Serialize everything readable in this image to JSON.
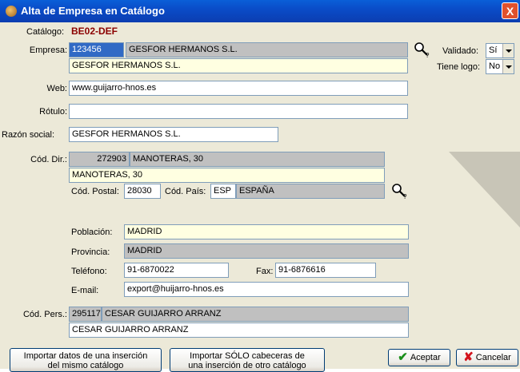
{
  "window": {
    "title": "Alta de Empresa en Catálogo",
    "close": "X"
  },
  "catalogo": {
    "label": "Catálogo:",
    "value": "BE02-DEF"
  },
  "empresa": {
    "label": "Empresa:",
    "code": "123456",
    "name": "GESFOR HERMANOS S.L.",
    "display_name": "GESFOR HERMANOS S.L."
  },
  "validado": {
    "label": "Validado:",
    "value": "Sí"
  },
  "tiene_logo": {
    "label": "Tiene logo:",
    "value": "No"
  },
  "web": {
    "label": "Web:",
    "value": "www.guijarro-hnos.es"
  },
  "rotulo": {
    "label": "Rótulo:",
    "value": ""
  },
  "razon_social": {
    "label": "Razón social:",
    "value": "GESFOR HERMANOS S.L."
  },
  "direccion": {
    "label": "Cód. Dir.:",
    "code": "272903",
    "street": "MANOTERAS, 30",
    "display_street": "MANOTERAS, 30",
    "cp_label": "Cód. Postal:",
    "cp": "28030",
    "pais_label": "Cód. País:",
    "pais_code": "ESP",
    "pais_name": "ESPAÑA",
    "poblacion_label": "Población:",
    "poblacion": "MADRID",
    "provincia_label": "Provincia:",
    "provincia": "MADRID",
    "telefono_label": "Teléfono:",
    "telefono": "91-6870022",
    "fax_label": "Fax:",
    "fax": "91-6876616",
    "email_label": "E-mail:",
    "email": "export@huijarro-hnos.es"
  },
  "persona": {
    "label": "Cód. Pers.:",
    "code": "295117",
    "name": "CESAR GUIJARRO ARRANZ",
    "display_name": "CESAR GUIJARRO ARRANZ"
  },
  "buttons": {
    "import_same_1": "Importar datos de una inserción",
    "import_same_2": "del mismo catálogo",
    "import_other_1": "Importar SÓLO cabeceras de",
    "import_other_2": "una inserción de otro catálogo",
    "accept": "Aceptar",
    "cancel": "Cancelar"
  }
}
